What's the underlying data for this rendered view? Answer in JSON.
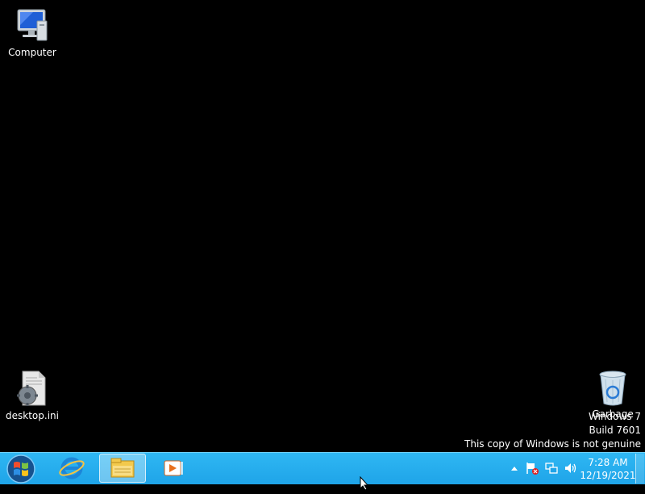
{
  "desktop": {
    "icons": [
      {
        "label": "Computer"
      },
      {
        "label": "desktop.ini"
      },
      {
        "label": "Garbage"
      }
    ],
    "watermark": {
      "line1": "Windows 7",
      "line2": "Build 7601",
      "line3": "This copy of Windows is not genuine"
    }
  },
  "taskbar": {
    "buttons": [
      {
        "icon": "internet-explorer-icon"
      },
      {
        "icon": "file-explorer-icon",
        "active": true
      },
      {
        "icon": "media-player-icon"
      }
    ],
    "tray": {
      "icons": [
        "show-hidden-icons-arrow",
        "action-center-flag-icon",
        "network-icon",
        "volume-icon"
      ],
      "time": "7:28 AM",
      "date": "12/19/2021"
    }
  },
  "colors": {
    "taskbar": "#2fb7f3",
    "desktop": "#000000"
  }
}
